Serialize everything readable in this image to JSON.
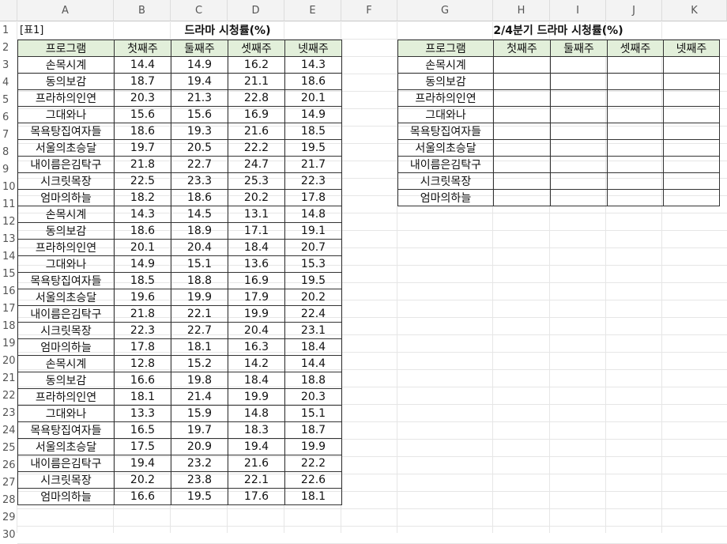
{
  "columns": [
    "",
    "A",
    "B",
    "C",
    "D",
    "E",
    "F",
    "G",
    "H",
    "I",
    "J",
    "K"
  ],
  "rows": [
    "1",
    "2",
    "3",
    "4",
    "5",
    "6",
    "7",
    "8",
    "9",
    "10",
    "11",
    "12",
    "13",
    "14",
    "15",
    "16",
    "17",
    "18",
    "19",
    "20",
    "21",
    "22",
    "23",
    "24",
    "25",
    "26",
    "27",
    "28",
    "29",
    "30"
  ],
  "table1": {
    "label": "[표1]",
    "title": "드라마 시청률(%)",
    "headers": [
      "프로그램",
      "첫째주",
      "둘째주",
      "셋째주",
      "넷째주"
    ],
    "rows": [
      [
        "손목시계",
        "14.4",
        "14.9",
        "16.2",
        "14.3"
      ],
      [
        "동의보감",
        "18.7",
        "19.4",
        "21.1",
        "18.6"
      ],
      [
        "프라하의인연",
        "20.3",
        "21.3",
        "22.8",
        "20.1"
      ],
      [
        "그대와나",
        "15.6",
        "15.6",
        "16.9",
        "14.9"
      ],
      [
        "목욕탕집여자들",
        "18.6",
        "19.3",
        "21.6",
        "18.5"
      ],
      [
        "서울의초승달",
        "19.7",
        "20.5",
        "22.2",
        "19.5"
      ],
      [
        "내이름은김탁구",
        "21.8",
        "22.7",
        "24.7",
        "21.7"
      ],
      [
        "시크릿목장",
        "22.5",
        "23.3",
        "25.3",
        "22.3"
      ],
      [
        "엄마의하늘",
        "18.2",
        "18.6",
        "20.2",
        "17.8"
      ],
      [
        "손목시계",
        "14.3",
        "14.5",
        "13.1",
        "14.8"
      ],
      [
        "동의보감",
        "18.6",
        "18.9",
        "17.1",
        "19.1"
      ],
      [
        "프라하의인연",
        "20.1",
        "20.4",
        "18.4",
        "20.7"
      ],
      [
        "그대와나",
        "14.9",
        "15.1",
        "13.6",
        "15.3"
      ],
      [
        "목욕탕집여자들",
        "18.5",
        "18.8",
        "16.9",
        "19.5"
      ],
      [
        "서울의초승달",
        "19.6",
        "19.9",
        "17.9",
        "20.2"
      ],
      [
        "내이름은김탁구",
        "21.8",
        "22.1",
        "19.9",
        "22.4"
      ],
      [
        "시크릿목장",
        "22.3",
        "22.7",
        "20.4",
        "23.1"
      ],
      [
        "엄마의하늘",
        "17.8",
        "18.1",
        "16.3",
        "18.4"
      ],
      [
        "손목시계",
        "12.8",
        "15.2",
        "14.2",
        "14.4"
      ],
      [
        "동의보감",
        "16.6",
        "19.8",
        "18.4",
        "18.8"
      ],
      [
        "프라하의인연",
        "18.1",
        "21.4",
        "19.9",
        "20.3"
      ],
      [
        "그대와나",
        "13.3",
        "15.9",
        "14.8",
        "15.1"
      ],
      [
        "목욕탕집여자들",
        "16.5",
        "19.7",
        "18.3",
        "18.7"
      ],
      [
        "서울의초승달",
        "17.5",
        "20.9",
        "19.4",
        "19.9"
      ],
      [
        "내이름은김탁구",
        "19.4",
        "23.2",
        "21.6",
        "22.2"
      ],
      [
        "시크릿목장",
        "20.2",
        "23.8",
        "22.1",
        "22.6"
      ],
      [
        "엄마의하늘",
        "16.6",
        "19.5",
        "17.6",
        "18.1"
      ]
    ]
  },
  "table2": {
    "title": "2/4분기 드라마 시청률(%)",
    "headers": [
      "프로그램",
      "첫째주",
      "둘째주",
      "셋째주",
      "넷째주"
    ],
    "rows": [
      [
        "손목시계",
        "",
        "",
        "",
        ""
      ],
      [
        "동의보감",
        "",
        "",
        "",
        ""
      ],
      [
        "프라하의인연",
        "",
        "",
        "",
        ""
      ],
      [
        "그대와나",
        "",
        "",
        "",
        ""
      ],
      [
        "목욕탕집여자들",
        "",
        "",
        "",
        ""
      ],
      [
        "서울의초승달",
        "",
        "",
        "",
        ""
      ],
      [
        "내이름은김탁구",
        "",
        "",
        "",
        ""
      ],
      [
        "시크릿목장",
        "",
        "",
        "",
        ""
      ],
      [
        "엄마의하늘",
        "",
        "",
        "",
        ""
      ]
    ]
  }
}
